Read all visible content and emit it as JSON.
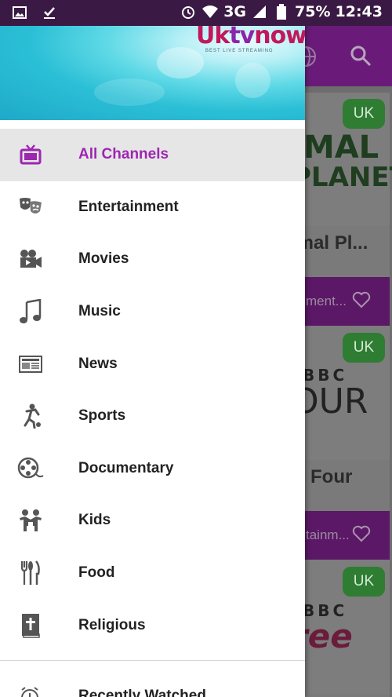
{
  "status_bar": {
    "network": "3G",
    "battery": "75%",
    "time": "12:43"
  },
  "drawer": {
    "brand_parts": [
      "Uk",
      "tv",
      "now"
    ],
    "brand_tagline": "BEST LIVE STREAMING",
    "menu": [
      {
        "label": "All Channels",
        "icon": "tv-icon",
        "active": true
      },
      {
        "label": "Entertainment",
        "icon": "theater-masks-icon"
      },
      {
        "label": "Movies",
        "icon": "movie-camera-icon"
      },
      {
        "label": "Music",
        "icon": "music-note-icon"
      },
      {
        "label": "News",
        "icon": "newspaper-icon"
      },
      {
        "label": "Sports",
        "icon": "soccer-player-icon"
      },
      {
        "label": "Documentary",
        "icon": "film-reel-icon"
      },
      {
        "label": "Kids",
        "icon": "kids-icon"
      },
      {
        "label": "Food",
        "icon": "cutlery-icon"
      },
      {
        "label": "Religious",
        "icon": "bible-icon"
      }
    ],
    "recent_label": "Recently Watched"
  },
  "background": {
    "cards": [
      {
        "badge": "UK",
        "logo_top": "IMAL",
        "logo_bottom": "PLANET",
        "name": "imal Pl...",
        "category": "ment..."
      },
      {
        "badge": "UK",
        "logo_top": "BBC",
        "logo_bottom": "OUR",
        "name": "C Four",
        "category": "tainm..."
      },
      {
        "badge": "UK",
        "logo_top": "BBC",
        "logo_bottom": "ree",
        "name": "",
        "category": ""
      }
    ]
  },
  "colors": {
    "accent": "#9c27b0",
    "appbar": "#6a1b79",
    "badge": "#2e7d32"
  }
}
